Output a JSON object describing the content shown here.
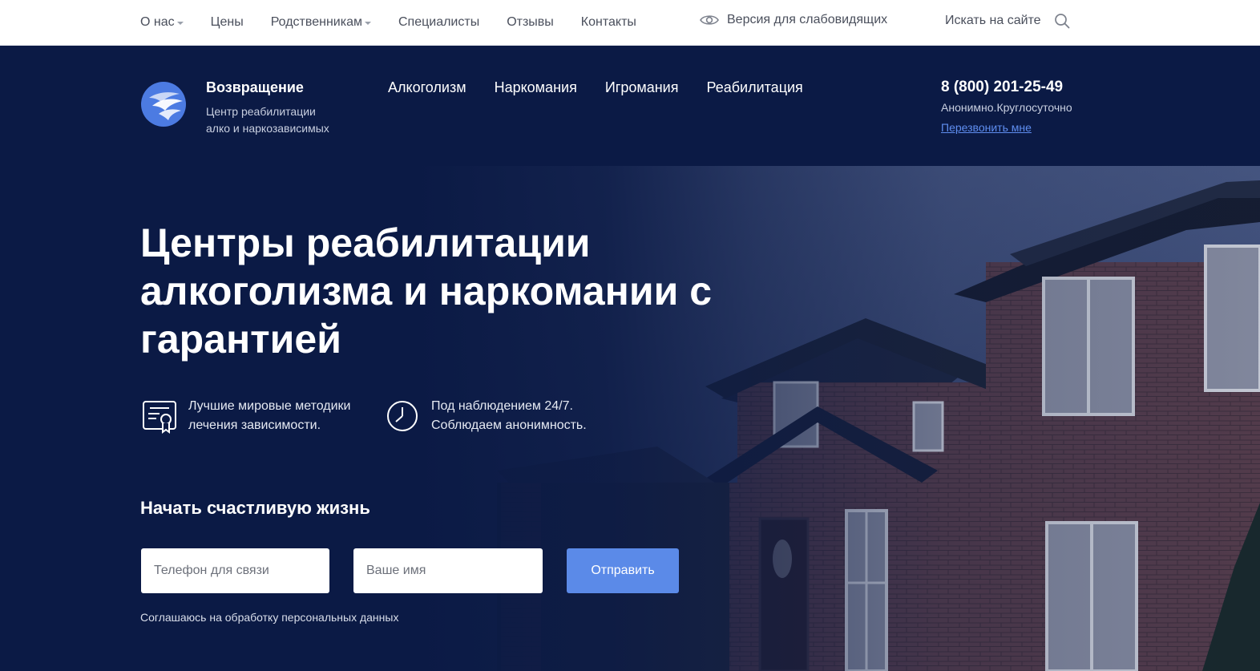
{
  "topbar": {
    "nav": [
      {
        "label": "О нас",
        "dropdown": true
      },
      {
        "label": "Цены",
        "dropdown": false
      },
      {
        "label": "Родственникам",
        "dropdown": true
      },
      {
        "label": "Специалисты",
        "dropdown": false
      },
      {
        "label": "Отзывы",
        "dropdown": false
      },
      {
        "label": "Контакты",
        "dropdown": false
      }
    ],
    "vision_label": "Версия для слабовидящих",
    "search_label": "Искать на сайте"
  },
  "header": {
    "brand_name": "Возвращение",
    "brand_sub_line1": "Центр реабилитации",
    "brand_sub_line2": "алко и наркозависимых",
    "nav": [
      "Алкоголизм",
      "Наркомания",
      "Игромания",
      "Реабилитация"
    ],
    "phone": "8 (800) 201-25-49",
    "phone_note": "Анонимно.Круглосуточно",
    "callback": "Перезвонить мне"
  },
  "hero": {
    "title_line1": "Центры реабилитации",
    "title_line2": "алкоголизма и наркомании с",
    "title_line3": "гарантией",
    "features": [
      {
        "icon": "certificate-icon",
        "line1": "Лучшие мировые методики",
        "line2": "лечения зависимости."
      },
      {
        "icon": "clock-icon",
        "line1": "Под наблюдением 24/7.",
        "line2": "Соблюдаем анонимность."
      }
    ],
    "form_title": "Начать счастливую жизнь",
    "phone_placeholder": "Телефон для связи",
    "name_placeholder": "Ваше имя",
    "submit_label": "Отправить",
    "consent": "Соглашаюсь на обработку персональных данных"
  },
  "colors": {
    "navy": "#0b1a45",
    "accent": "#5b8ae8",
    "link": "#5f8ef0",
    "topbar_bg": "#ffffff"
  }
}
